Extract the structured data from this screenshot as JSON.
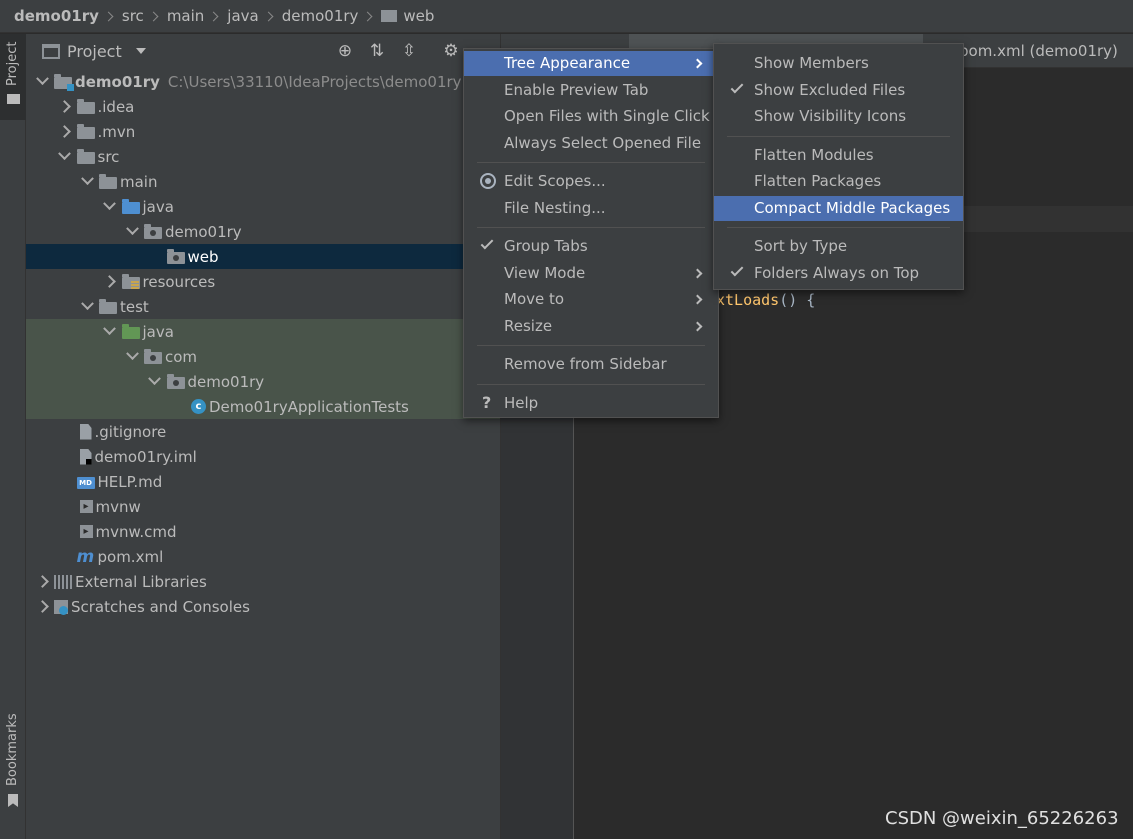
{
  "breadcrumb": [
    "demo01ry",
    "src",
    "main",
    "java",
    "demo01ry",
    "web"
  ],
  "strip": {
    "project_tab": "Project",
    "bookmarks_tab": "Bookmarks"
  },
  "panel": {
    "title": "Project"
  },
  "tree": [
    {
      "label": "demo01ry",
      "path": "C:\\Users\\33110\\IdeaProjects\\demo01ry",
      "indent": 0,
      "arrow": "down",
      "icon": "folder mod",
      "bold": true,
      "state": ""
    },
    {
      "label": ".idea",
      "indent": 1,
      "arrow": "right",
      "icon": "folder",
      "state": ""
    },
    {
      "label": ".mvn",
      "indent": 1,
      "arrow": "right",
      "icon": "folder",
      "state": ""
    },
    {
      "label": "src",
      "indent": 1,
      "arrow": "down",
      "icon": "folder",
      "state": ""
    },
    {
      "label": "main",
      "indent": 2,
      "arrow": "down",
      "icon": "folder",
      "state": ""
    },
    {
      "label": "java",
      "indent": 3,
      "arrow": "down",
      "icon": "folder blue",
      "state": ""
    },
    {
      "label": "demo01ry",
      "indent": 4,
      "arrow": "down",
      "icon": "folder pkg",
      "state": ""
    },
    {
      "label": "web",
      "indent": 5,
      "arrow": "none",
      "icon": "folder pkg",
      "state": "sel"
    },
    {
      "label": "resources",
      "indent": 3,
      "arrow": "right",
      "icon": "folder res",
      "state": ""
    },
    {
      "label": "test",
      "indent": 2,
      "arrow": "down",
      "icon": "folder",
      "state": ""
    },
    {
      "label": "java",
      "indent": 3,
      "arrow": "down",
      "icon": "folder green",
      "state": "test"
    },
    {
      "label": "com",
      "indent": 4,
      "arrow": "down",
      "icon": "folder pkg",
      "state": "test"
    },
    {
      "label": "demo01ry",
      "indent": 5,
      "arrow": "down",
      "icon": "folder pkg",
      "state": "test"
    },
    {
      "label": "Demo01ryApplicationTests",
      "indent": 6,
      "arrow": "none",
      "icon": "cls",
      "state": "test"
    },
    {
      "label": ".gitignore",
      "indent": 1,
      "arrow": "none",
      "icon": "file",
      "state": ""
    },
    {
      "label": "demo01ry.iml",
      "indent": 1,
      "arrow": "none",
      "icon": "file dark",
      "state": ""
    },
    {
      "label": "HELP.md",
      "indent": 1,
      "arrow": "none",
      "icon": "md-badge",
      "state": ""
    },
    {
      "label": "mvnw",
      "indent": 1,
      "arrow": "none",
      "icon": "term",
      "state": ""
    },
    {
      "label": "mvnw.cmd",
      "indent": 1,
      "arrow": "none",
      "icon": "term",
      "state": ""
    },
    {
      "label": "pom.xml",
      "indent": 1,
      "arrow": "none",
      "icon": "mvn-m",
      "state": ""
    },
    {
      "label": "External Libraries",
      "indent": 0,
      "arrow": "right",
      "icon": "lib",
      "state": ""
    },
    {
      "label": "Scratches and Consoles",
      "indent": 0,
      "arrow": "right",
      "icon": "scratch",
      "state": ""
    }
  ],
  "icon_glyphs": {
    "md-badge": "MD",
    "term": "▸",
    "mvn-m": "m",
    "cls": "c"
  },
  "editor": {
    "tab_label": "pom.xml (demo01ry)",
    "code_text": "xtLoads",
    "code_rest": "() {"
  },
  "main_menu": [
    {
      "label": "Tree Appearance",
      "submenu": true,
      "highlight": true
    },
    {
      "label": "Enable Preview Tab"
    },
    {
      "label": "Open Files with Single Click"
    },
    {
      "label": "Always Select Opened File"
    },
    {
      "separator": true
    },
    {
      "label": "Edit Scopes...",
      "radio": true
    },
    {
      "label": "File Nesting..."
    },
    {
      "separator": true
    },
    {
      "label": "Group Tabs",
      "check": true
    },
    {
      "label": "View Mode",
      "submenu": true
    },
    {
      "label": "Move to",
      "submenu": true
    },
    {
      "label": "Resize",
      "submenu": true
    },
    {
      "separator": true
    },
    {
      "label": "Remove from Sidebar"
    },
    {
      "separator": true
    },
    {
      "label": "Help",
      "help": true
    }
  ],
  "help_glyph": "?",
  "sub_menu": [
    {
      "label": "Show Members"
    },
    {
      "label": "Show Excluded Files",
      "check": true
    },
    {
      "label": "Show Visibility Icons"
    },
    {
      "separator": true
    },
    {
      "label": "Flatten Modules"
    },
    {
      "label": "Flatten Packages"
    },
    {
      "label": "Compact Middle Packages",
      "highlight": true
    },
    {
      "separator": true
    },
    {
      "label": "Sort by Type"
    },
    {
      "label": "Folders Always on Top",
      "check": true
    }
  ],
  "watermark": "CSDN @weixin_65226263"
}
